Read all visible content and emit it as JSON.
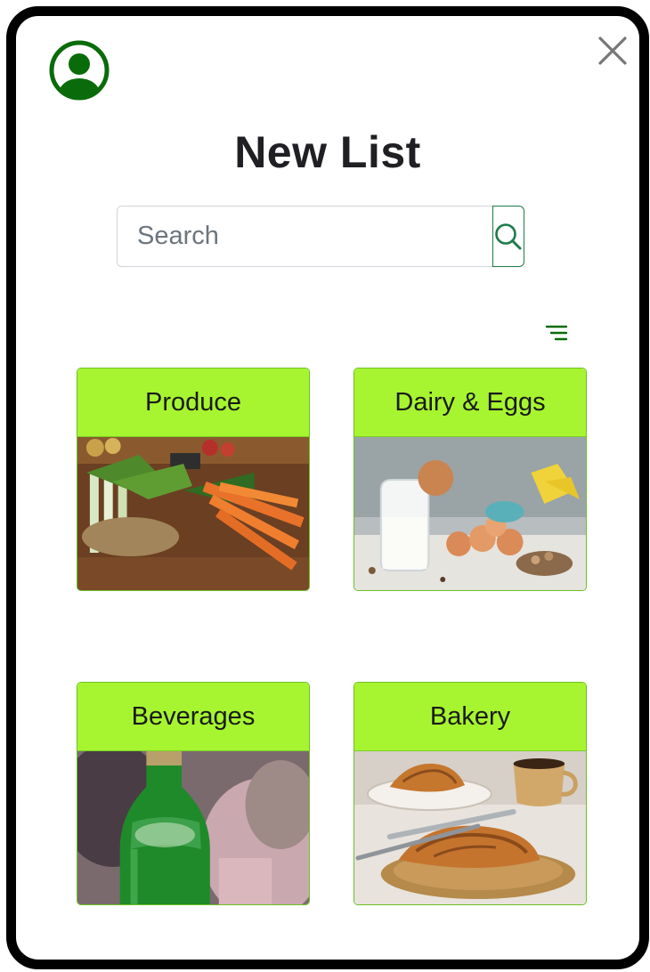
{
  "header": {
    "title": "New List"
  },
  "search": {
    "placeholder": "Search"
  },
  "categories": [
    {
      "label": "Produce"
    },
    {
      "label": "Dairy & Eggs"
    },
    {
      "label": "Beverages"
    },
    {
      "label": "Bakery"
    }
  ],
  "colors": {
    "accent": "#0a6b0a",
    "card_header": "#a6f530",
    "search_border": "#1e7a4b"
  },
  "icons": [
    "user-avatar-icon",
    "close-icon",
    "search-icon",
    "filter-icon"
  ]
}
